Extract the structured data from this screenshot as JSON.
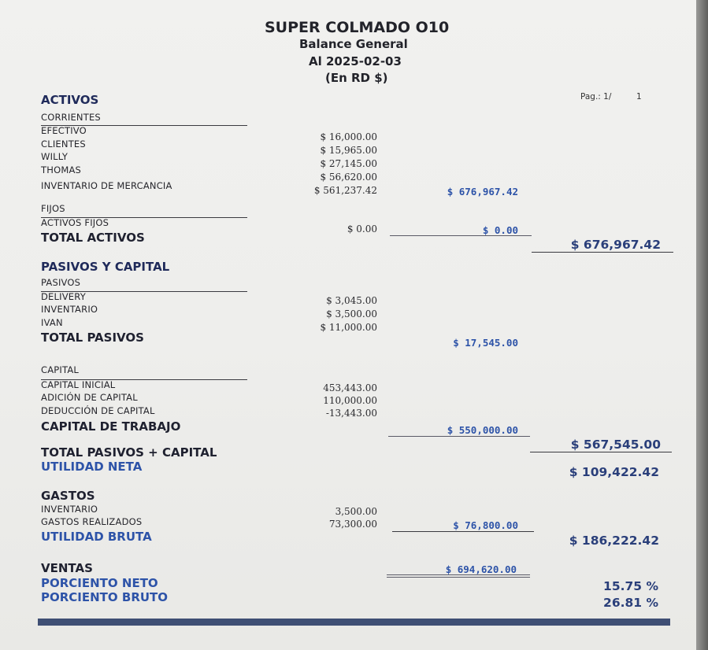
{
  "header": {
    "company": "SUPER COLMADO O10",
    "title": "Balance General",
    "date": "Al 2025-02-03",
    "currency": "(En RD $)",
    "page_label": "Pag.: 1/",
    "page_total": "1"
  },
  "activos": {
    "heading": "ACTIVOS",
    "corrientes": {
      "label": "CORRIENTES",
      "items": [
        {
          "label": "EFECTIVO",
          "amount": "$ 16,000.00"
        },
        {
          "label": "CLIENTES",
          "amount": "$ 15,965.00"
        },
        {
          "label": "WILLY",
          "amount": "$ 27,145.00"
        },
        {
          "label": "THOMAS",
          "amount": "$ 56,620.00"
        },
        {
          "label": "INVENTARIO DE MERCANCIA",
          "amount": "$ 561,237.42"
        }
      ],
      "subtotal": "$ 676,967.42"
    },
    "fijos": {
      "label": "FIJOS",
      "items": [
        {
          "label": "ACTIVOS FIJOS",
          "amount": "$ 0.00"
        }
      ],
      "subtotal": "$ 0.00"
    },
    "total_label": "TOTAL ACTIVOS",
    "total": "$ 676,967.42"
  },
  "pasivos_capital": {
    "heading": "PASIVOS Y CAPITAL",
    "pasivos": {
      "label": "PASIVOS",
      "items": [
        {
          "label": "DELIVERY",
          "amount": "$ 3,045.00"
        },
        {
          "label": "INVENTARIO",
          "amount": "$ 3,500.00"
        },
        {
          "label": "IVAN",
          "amount": "$ 11,000.00"
        }
      ],
      "total_label": "TOTAL PASIVOS",
      "total": "$ 17,545.00"
    },
    "capital": {
      "label": "CAPITAL",
      "items": [
        {
          "label": "CAPITAL INICIAL",
          "amount": "453,443.00"
        },
        {
          "label": "ADICIÓN DE CAPITAL",
          "amount": "110,000.00"
        },
        {
          "label": "DEDUCCIÓN DE CAPITAL",
          "amount": "-13,443.00"
        }
      ],
      "total_label": "CAPITAL DE TRABAJO",
      "total": "$ 550,000.00"
    },
    "total_label": "TOTAL PASIVOS + CAPITAL",
    "total": "$ 567,545.00"
  },
  "utilidad_neta": {
    "label": "UTILIDAD NETA",
    "value": "$ 109,422.42"
  },
  "gastos": {
    "heading": "GASTOS",
    "items": [
      {
        "label": "INVENTARIO",
        "amount": "3,500.00"
      },
      {
        "label": "GASTOS REALIZADOS",
        "amount": "73,300.00"
      }
    ],
    "subtotal": "$ 76,800.00"
  },
  "utilidad_bruta": {
    "label": "UTILIDAD BRUTA",
    "value": "$ 186,222.42"
  },
  "ventas": {
    "label": "VENTAS",
    "value": "$ 694,620.00"
  },
  "porciento_neto": {
    "label": "PORCIENTO NETO",
    "value": "15.75 %"
  },
  "porciento_bruto": {
    "label": "PORCIENTO BRUTO",
    "value": "26.81 %"
  }
}
